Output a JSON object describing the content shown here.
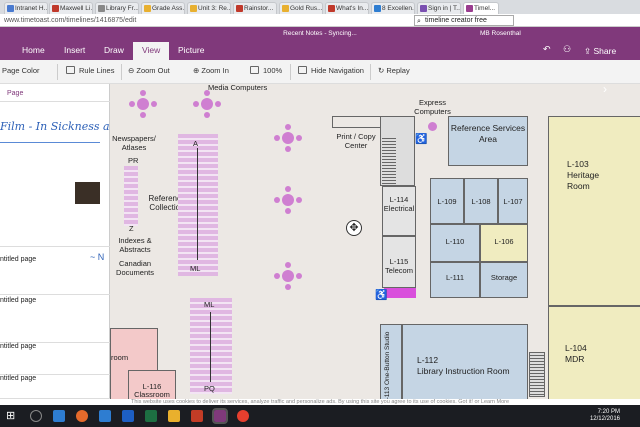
{
  "browser": {
    "tabs": [
      {
        "label": "Intranet H...",
        "color": "#4a7bd0"
      },
      {
        "label": "Maxwell Li...",
        "color": "#c0392b"
      },
      {
        "label": "Library Fr...",
        "color": "#888888"
      },
      {
        "label": "Grade Ass...",
        "color": "#e8b030"
      },
      {
        "label": "Unit 3: Re...",
        "color": "#e8b030"
      },
      {
        "label": "Rainstor...",
        "color": "#c0392b"
      },
      {
        "label": "Gold Rus...",
        "color": "#e8b030"
      },
      {
        "label": "What's In...",
        "color": "#c0392b"
      },
      {
        "label": "8 Excellen...",
        "color": "#2e7dd1"
      },
      {
        "label": "Sign in | T...",
        "color": "#7a4fb0"
      },
      {
        "label": "Timel...",
        "color": "#9a3d8f"
      }
    ],
    "url": "www.timetoast.com/timelines/1416875/edit",
    "find": "timeline creator free"
  },
  "onenote": {
    "title": "Recent Notes - Syncing...",
    "user": "MB Rosenthal",
    "ribbon_tabs": [
      "Home",
      "Insert",
      "Draw",
      "View",
      "Picture"
    ],
    "share": "Share",
    "toolbar": {
      "page_color": "Page Color",
      "rule_lines": "Rule Lines",
      "zoom_out": "Zoom Out",
      "zoom_in": "Zoom In",
      "zoom_pct": "100%",
      "hide_nav": "Hide Navigation",
      "replay": "Replay"
    }
  },
  "left_panel": {
    "page_header": "Page",
    "handwriting": "Film - In Sickness a",
    "pages": [
      "ntitled page",
      "ntitled page",
      "ntitled page",
      "ntitled page"
    ]
  },
  "map": {
    "media_computers": "Media Computers",
    "express_computers": "Express Computers",
    "print_copy": "Print / Copy Center",
    "reference_services": "Reference Services Area",
    "heritage": {
      "num": "L-103",
      "name": "Heritage Room"
    },
    "newspapers": "Newspapers/ Atlases",
    "pr": "PR",
    "z": "Z",
    "a": "A",
    "ml_top": "ML",
    "reference_collection": "Reference Collection",
    "indexes": "Indexes & Abstracts",
    "canadian": "Canadian Documents",
    "electrical": {
      "num": "L-114",
      "name": "Electrical"
    },
    "telecom": {
      "num": "L-115",
      "name": "Telecom"
    },
    "rooms": {
      "l109": "L-109",
      "l108": "L-108",
      "l107": "L-107",
      "l110": "L-110",
      "l106": "L-106",
      "l111": "L-111",
      "storage": "Storage"
    },
    "ml_bottom": "ML",
    "pq": "PQ",
    "mdr": {
      "num": "L-104",
      "name": "MDR"
    },
    "instruction": {
      "num": "L-112",
      "name": "Library Instruction Room"
    },
    "studio": "L-113 One-Button Studio",
    "classroom": {
      "num": "L-116",
      "name": "Classroom"
    },
    "room_partial": "room"
  },
  "cookie_text": "This website uses cookies to deliver its services, analyze traffic and personalize ads. By using this site you agree to its use of cookies. Got it! or Learn More",
  "clock": {
    "time": "7:20 PM",
    "date": "12/12/2016"
  }
}
